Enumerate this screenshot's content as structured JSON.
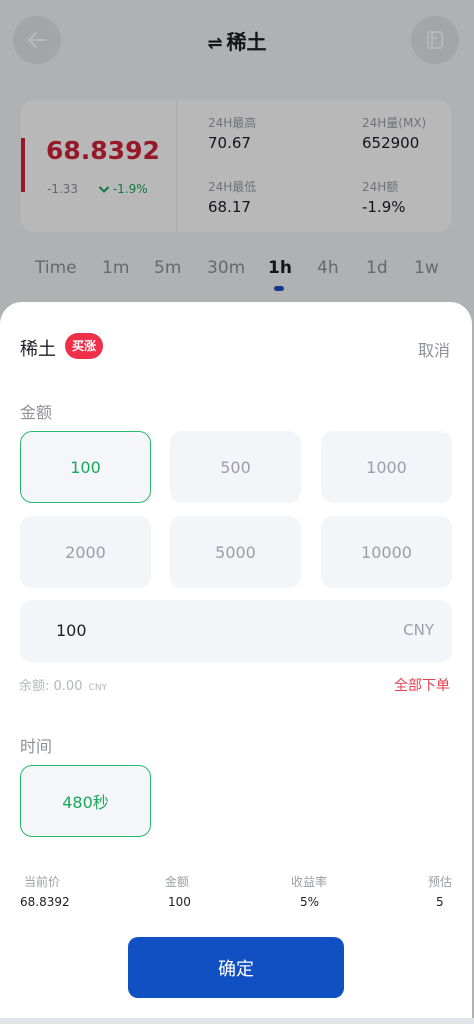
{
  "header": {
    "swap_glyph": "⇌",
    "title": "稀土"
  },
  "stats": {
    "price": "68.8392",
    "change": "-1.33",
    "change_pct": "-1.9%",
    "high_label": "24H最高",
    "high_value": "70.67",
    "volume_label": "24H量(MX)",
    "volume_value": "652900",
    "low_label": "24H最低",
    "low_value": "68.17",
    "amount_label": "24H额",
    "amount_value": "-1.9%"
  },
  "timeframes": [
    "Time",
    "1m",
    "5m",
    "30m",
    "1h",
    "4h",
    "1d",
    "1w"
  ],
  "active_timeframe": "1h",
  "sheet": {
    "title": "稀土",
    "badge": "买涨",
    "cancel": "取消",
    "amount_label": "金额",
    "amount_options": [
      "100",
      "500",
      "1000",
      "2000",
      "5000",
      "10000"
    ],
    "selected_amount": "100",
    "input_value": "100",
    "input_unit": "CNY",
    "balance_label": "余额:",
    "balance_value": "0.00",
    "balance_currency": "CNY",
    "all_order": "全部下单",
    "time_label": "时间",
    "time_option": "480秒"
  },
  "summary": {
    "headers": [
      "当前价",
      "金额",
      "收益率",
      "预估"
    ],
    "values": [
      "68.8392",
      "100",
      "5%",
      "5"
    ]
  },
  "confirm": "确定",
  "colors": {
    "accent_red": "#d0233a",
    "positive_green": "#1aa85a",
    "primary_blue": "#1150c3"
  }
}
